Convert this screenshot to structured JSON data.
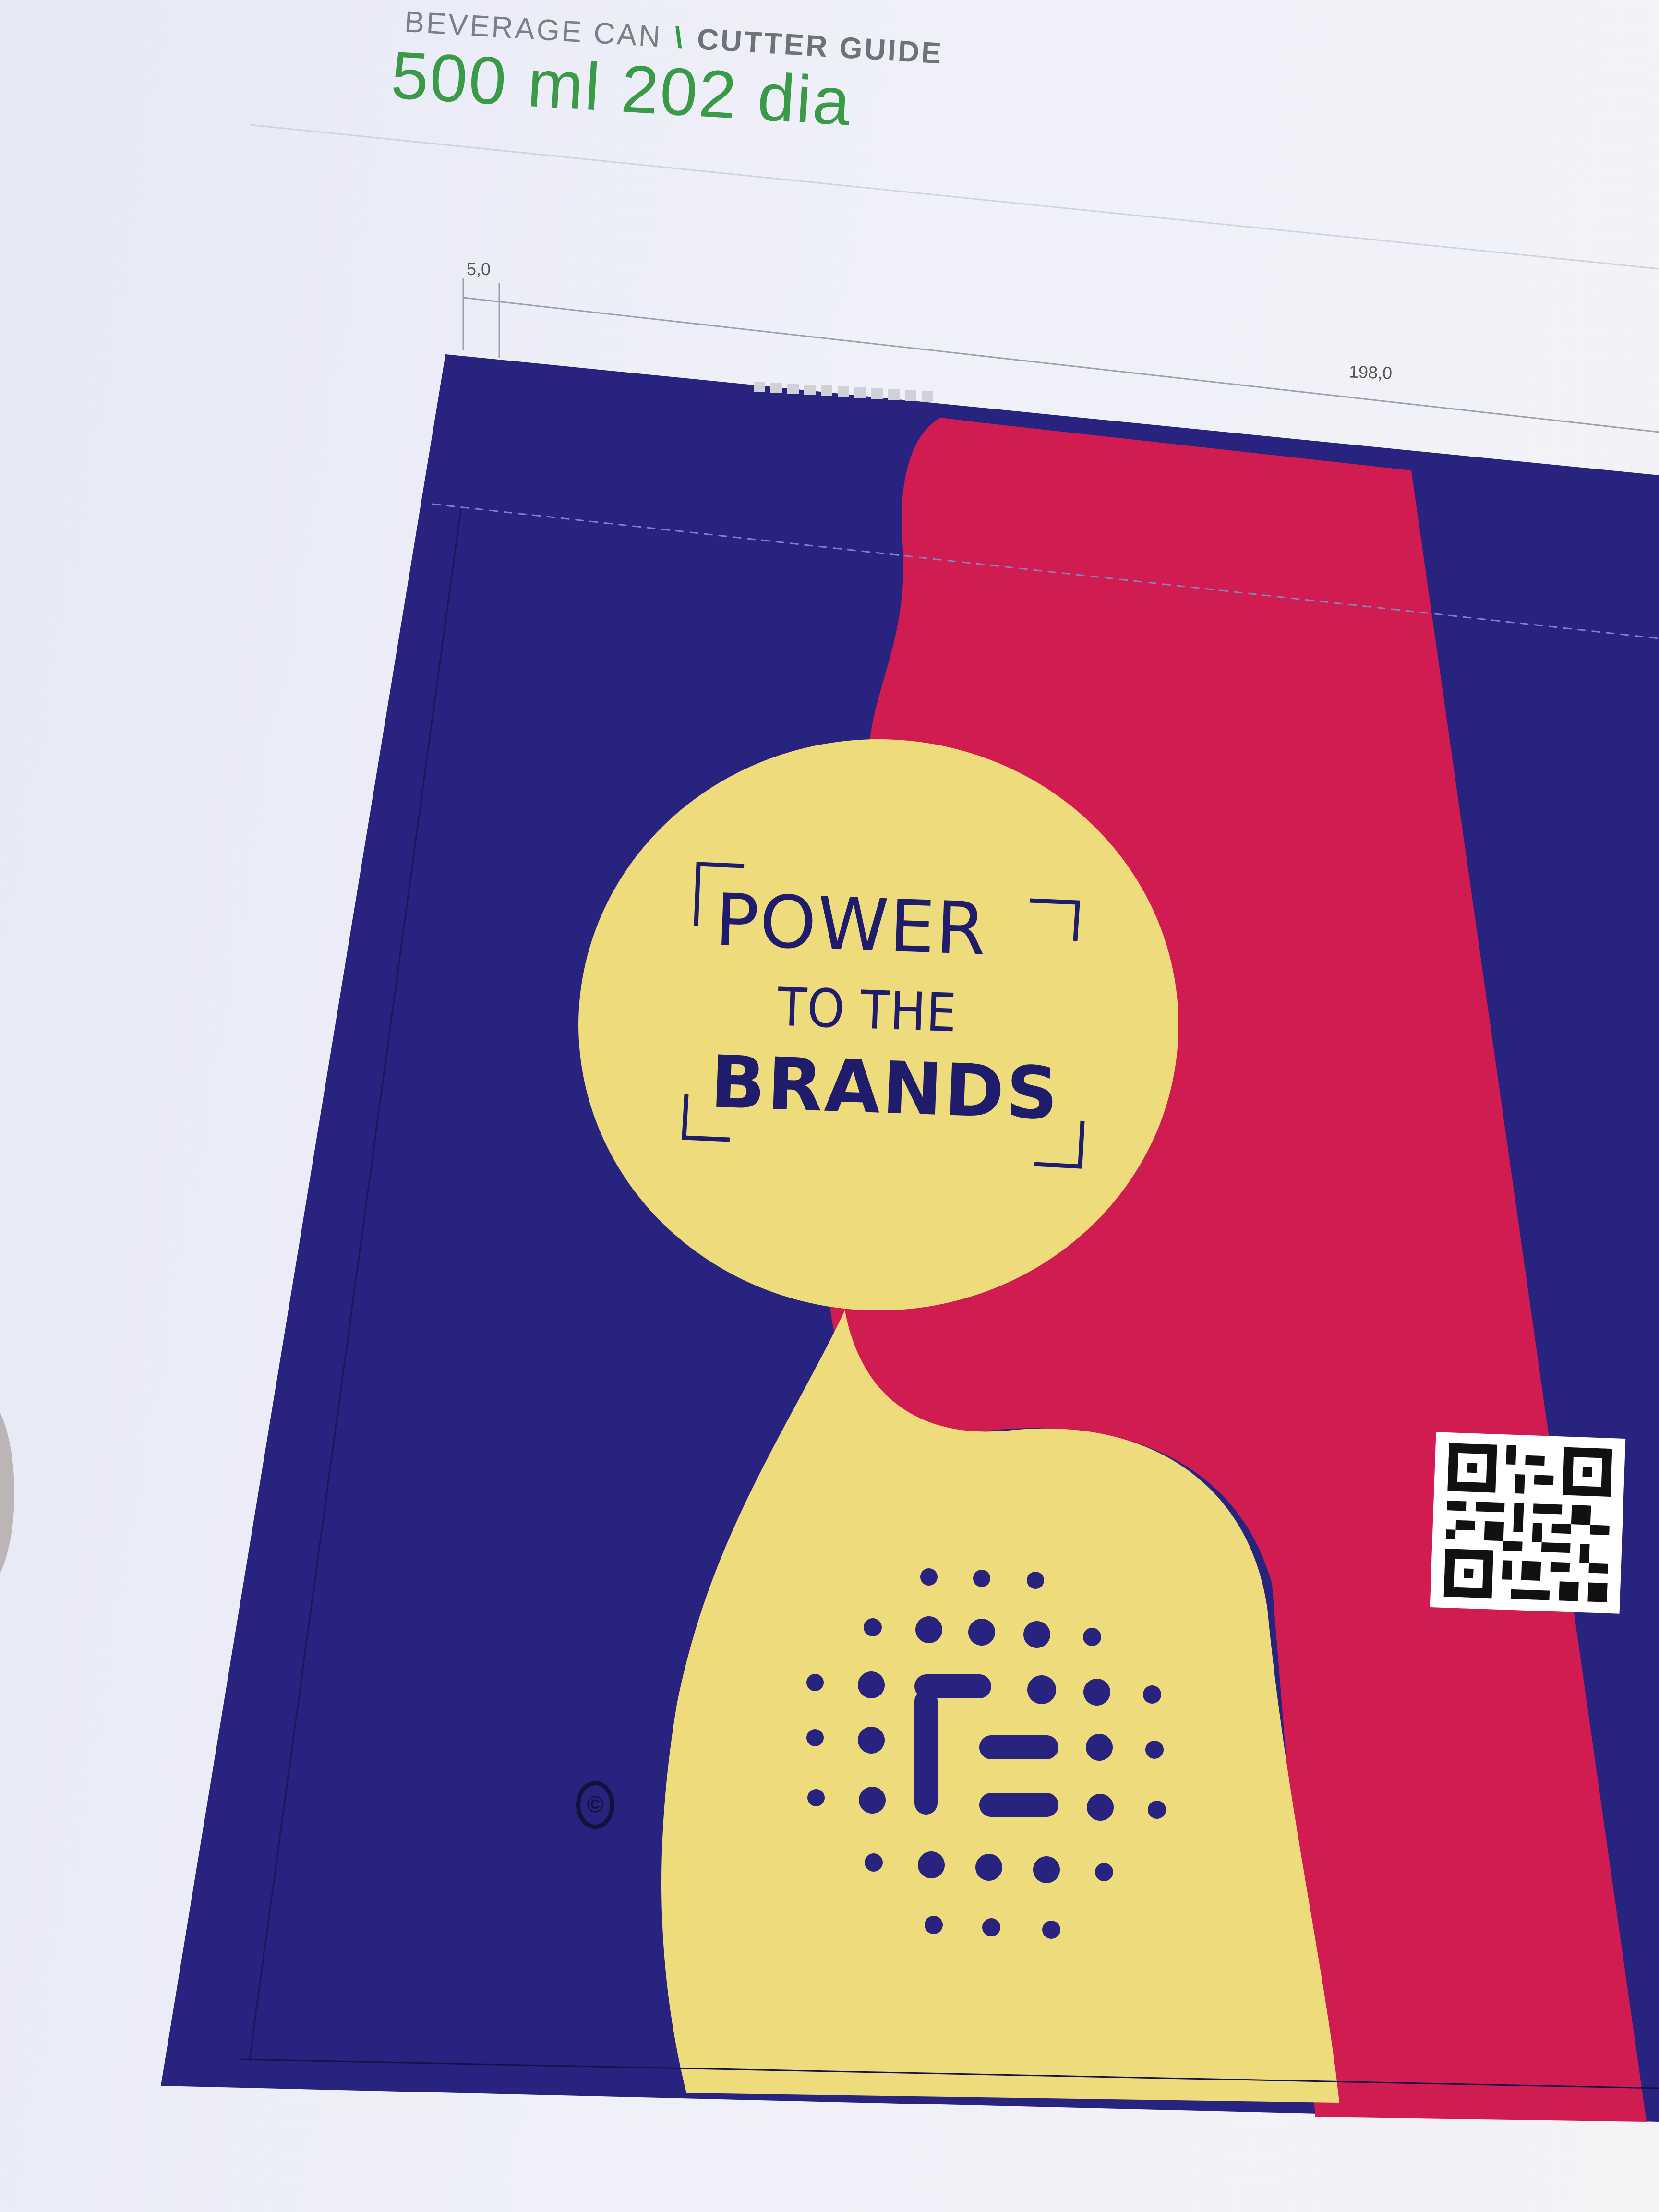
{
  "header": {
    "kicker_left": "BEVERAGE CAN",
    "kicker_separator": "\\",
    "kicker_right": "CUTTER GUIDE",
    "title": "500 ml 202 dia"
  },
  "dimensions": {
    "left_margin": "5,0",
    "width": "198,0"
  },
  "artwork": {
    "headline_line1": "POWER",
    "headline_line2": "TO THE",
    "headline_line3": "BRANDS",
    "symbol": "©",
    "colors": {
      "navy": "#27237e",
      "crimson": "#d01c50",
      "yellow": "#eedb7c",
      "ink": "#1f1c6b"
    },
    "icons": [
      "qr-code-icon",
      "dot-grid-logo-icon",
      "registered-mark-icon"
    ]
  }
}
